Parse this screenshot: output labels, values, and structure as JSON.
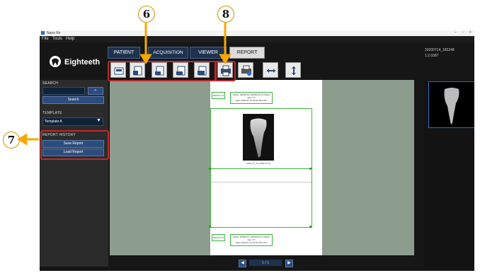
{
  "window": {
    "title": "Nano Rx"
  },
  "menu": {
    "items": [
      "File",
      "Tools",
      "Help"
    ]
  },
  "logo": {
    "text": "Eighteeth"
  },
  "tabs": [
    "PATIENT",
    "ACQUISITION",
    "VIEWER",
    "REPORT"
  ],
  "header_info": {
    "line1": "20200714_185248",
    "line2": "1.2.0387"
  },
  "search": {
    "label": "SEARCH",
    "value": "",
    "small_button": "+",
    "button": "Search"
  },
  "template": {
    "label": "TEMPLATE",
    "selected": "Template A"
  },
  "report_history": {
    "label": "REPORT HISTORY",
    "save": "Save Report",
    "load": "Load Report"
  },
  "toolbar": {
    "icons": [
      "template-layout-1-icon",
      "template-layout-2-icon",
      "template-layout-3-icon",
      "template-layout-4-icon",
      "template-layout-5-icon",
      "print-preview-icon",
      "print-icon",
      "fit-width-icon",
      "fit-height-icon"
    ]
  },
  "paper": {
    "header_date": "2020-07-14",
    "header_info": "Clarity: 20200714_185248 Armin Weiss\nAge: 3 5\nDate: 2020-07-14 18:52:48 (UTC)",
    "image_caption": "2020_07_14_2020-07-14",
    "footer_date": "2020-07-14",
    "footer_info": "Clarity: 20200714_185248 Armin Weiss\nAge: 3 5\nDate: 2020-07-14 18:52:48 (UTC)"
  },
  "pager": {
    "text": "1 / 1"
  },
  "callouts": {
    "six": "6",
    "seven": "7",
    "eight": "8"
  },
  "colors": {
    "accent_blue": "#2b4c7e",
    "highlight_red": "#c0282c",
    "callout_arrow": "#f5a800",
    "green_frame": "#3ab53a"
  }
}
